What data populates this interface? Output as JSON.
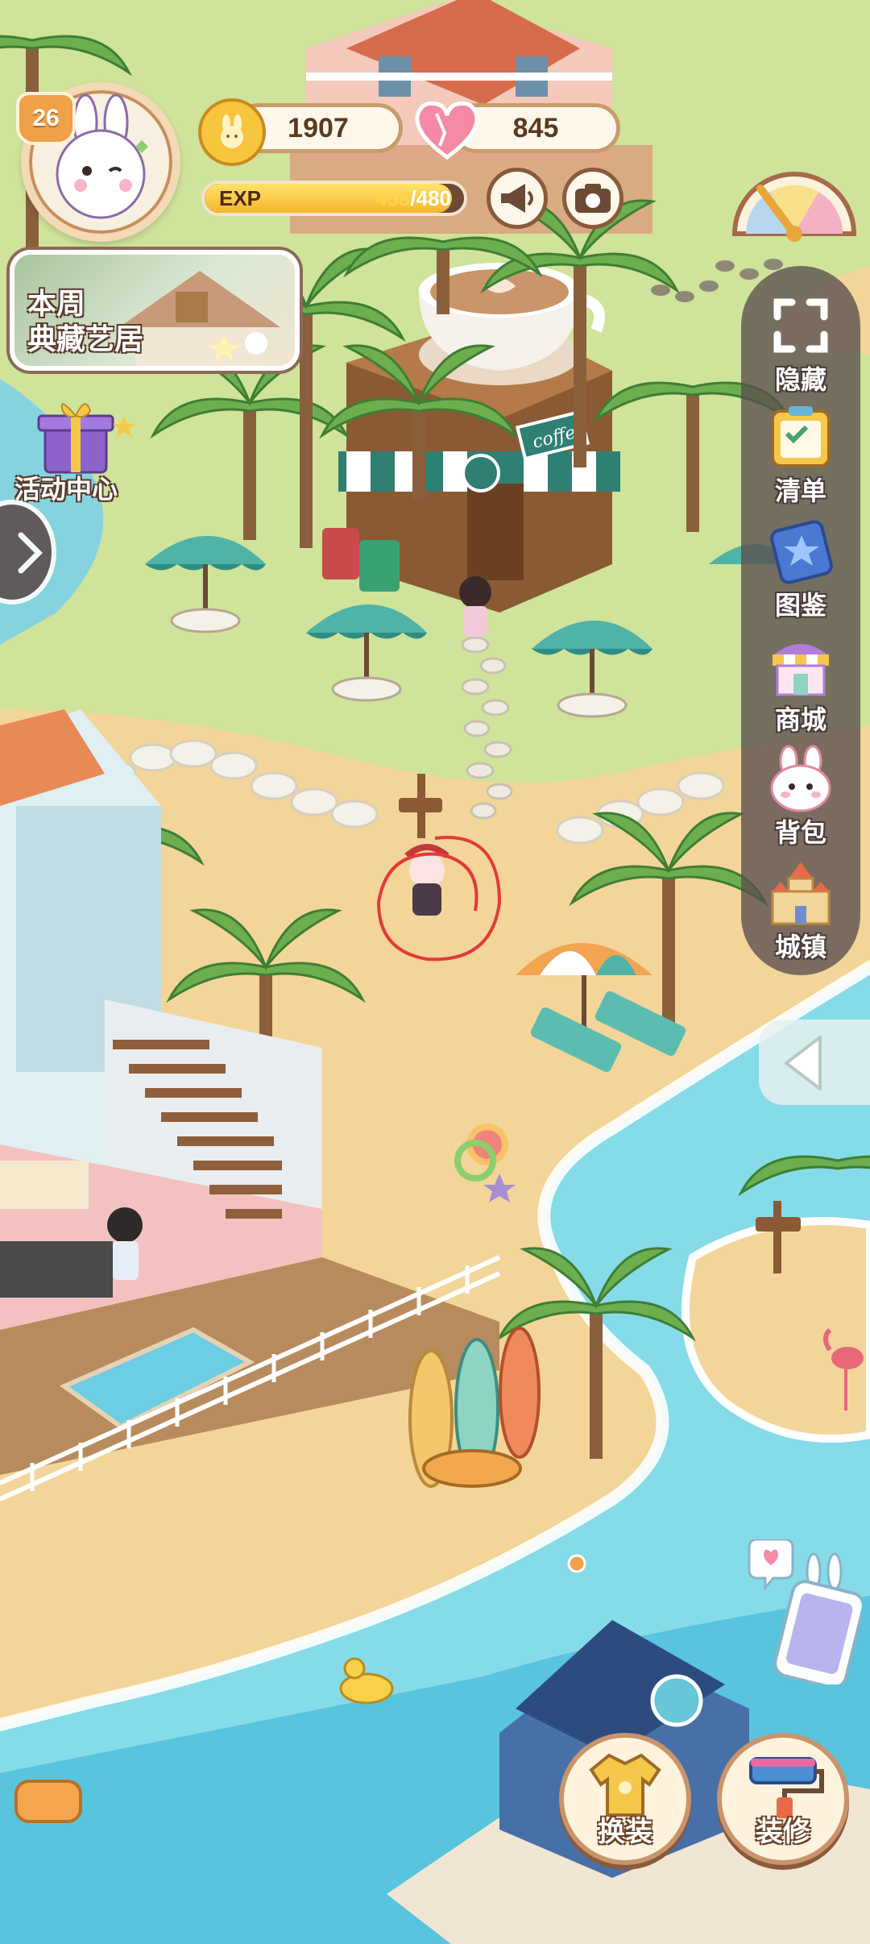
{
  "hud": {
    "level": "26",
    "coins": "1907",
    "hearts": "845",
    "exp_label": "EXP",
    "exp_current": "458",
    "exp_max": "/480",
    "exp_progress": 0.954
  },
  "event_card": {
    "line1": "本周",
    "line2": "典藏艺居"
  },
  "activity_center": {
    "label": "活动中心"
  },
  "side_menu": {
    "items": [
      {
        "label": "隐藏",
        "icon": "expand-icon"
      },
      {
        "label": "清单",
        "icon": "checklist-icon"
      },
      {
        "label": "图鉴",
        "icon": "star-book-icon"
      },
      {
        "label": "商城",
        "icon": "shop-icon"
      },
      {
        "label": "背包",
        "icon": "bunny-bag-icon"
      },
      {
        "label": "城镇",
        "icon": "castle-icon"
      }
    ]
  },
  "scene": {
    "cafe_sign": "coffee"
  },
  "bottom_actions": {
    "dress_up": "换装",
    "decorate": "装修"
  },
  "colors": {
    "grass": "#cfe39a",
    "sand": "#f3d59a",
    "sea": "#7fd6e6",
    "deep_sea": "#4fc0da",
    "panel": "#5a4e4e"
  }
}
